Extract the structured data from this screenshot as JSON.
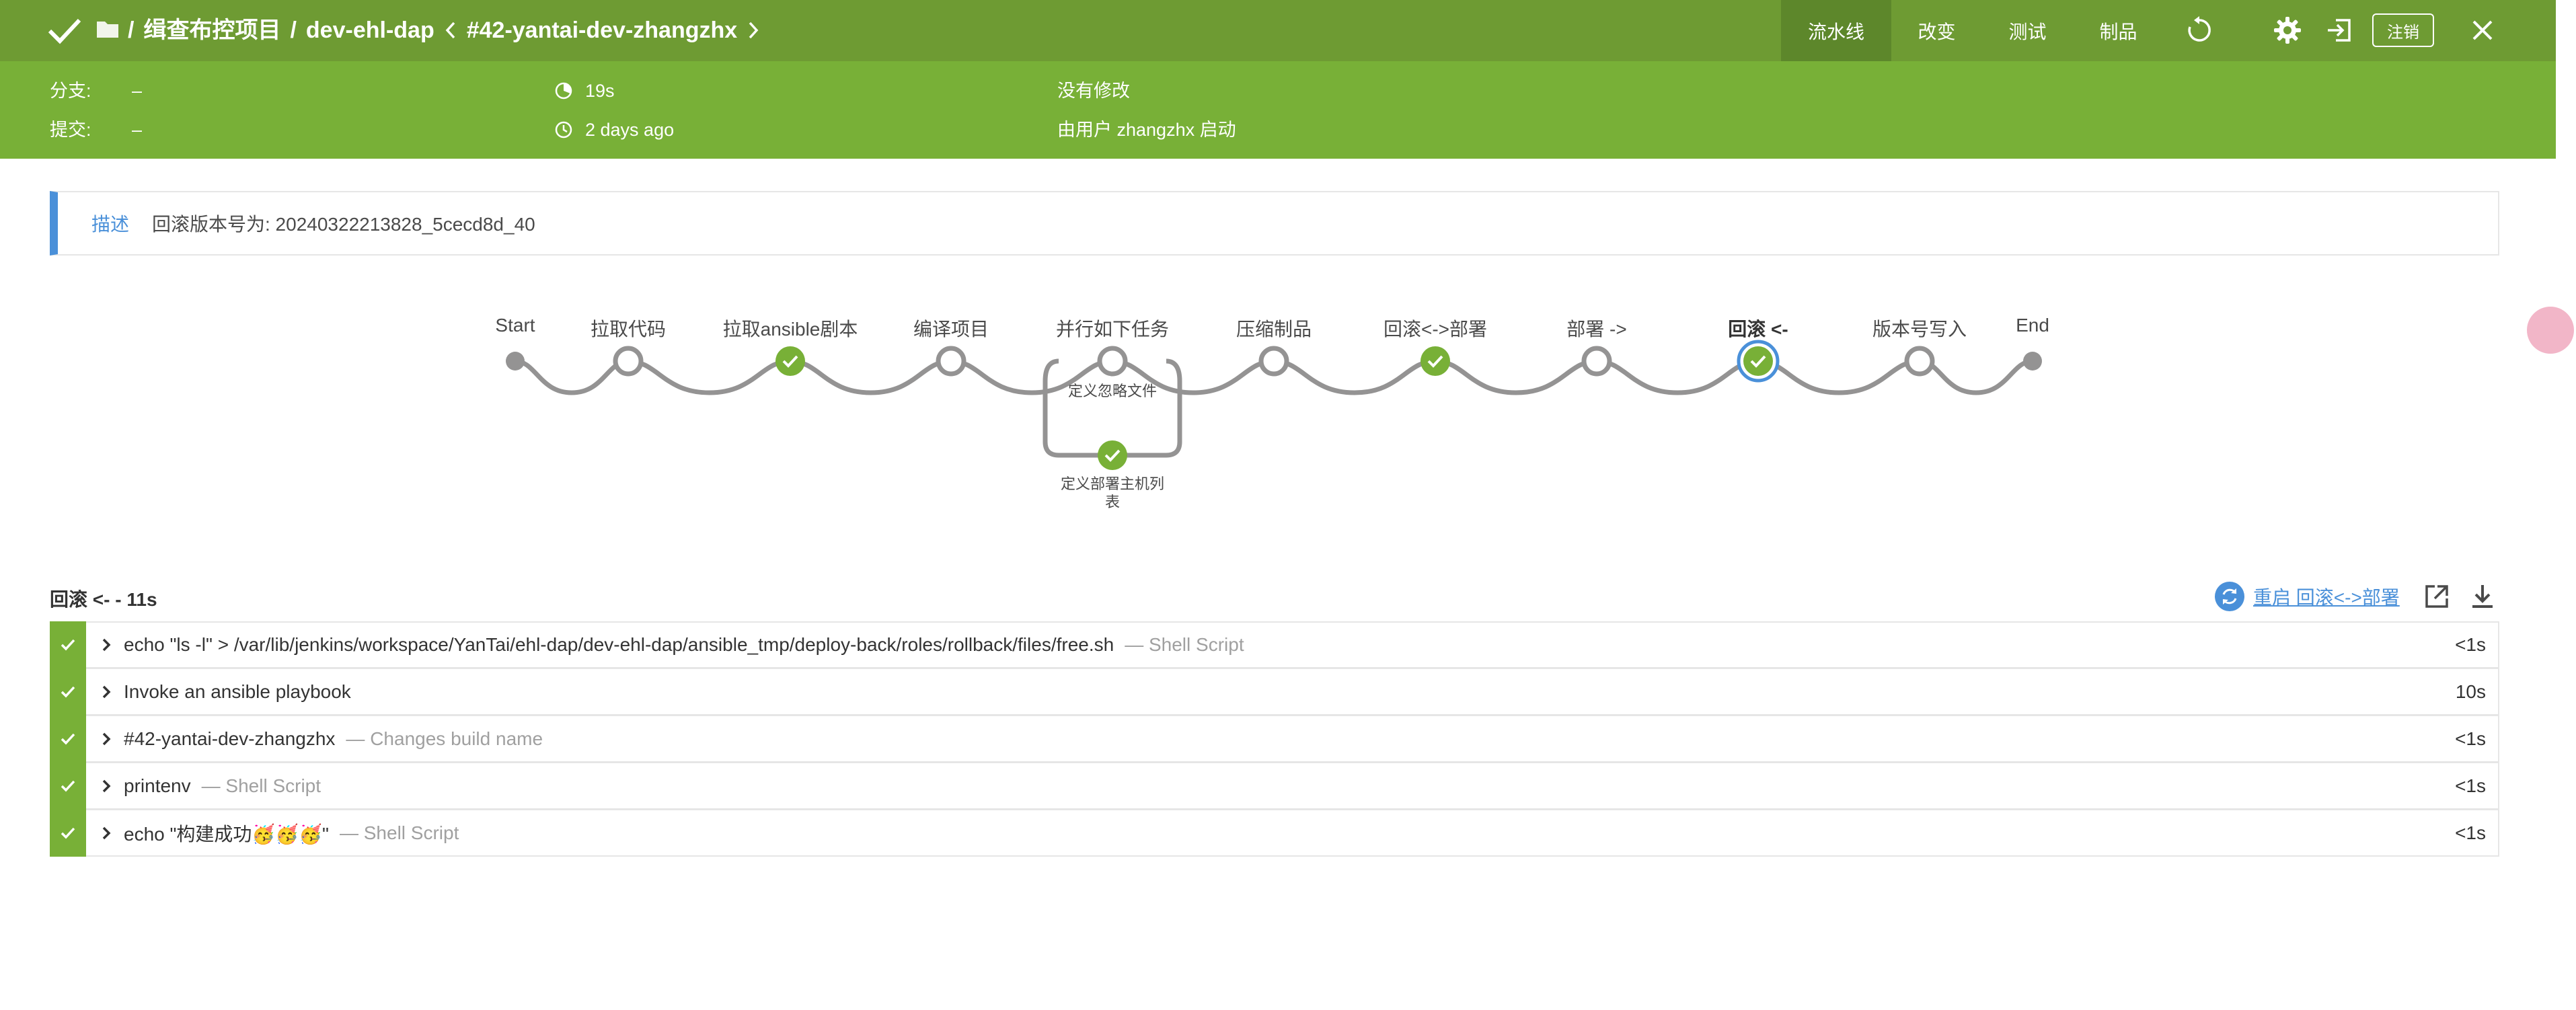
{
  "header": {
    "breadcrumb": {
      "project": "缉查布控项目",
      "job": "dev-ehl-dap",
      "build": "#42-yantai-dev-zhangzhx",
      "sep": "/"
    },
    "tabs": [
      {
        "label": "流水线",
        "active": true
      },
      {
        "label": "改变",
        "active": false
      },
      {
        "label": "测试",
        "active": false
      },
      {
        "label": "制品",
        "active": false
      }
    ],
    "logout_label": "注销",
    "icons": [
      "check-icon",
      "folder-icon",
      "chevron-left-icon",
      "chevron-right-icon",
      "replay-icon",
      "gear-icon",
      "exit-icon",
      "close-icon"
    ]
  },
  "summary": {
    "branch_label": "分支:",
    "branch_value": "–",
    "commit_label": "提交:",
    "commit_value": "–",
    "duration": "19s",
    "time_ago": "2 days ago",
    "changes": "没有修改",
    "started_by": "由用户 zhangzhx 启动"
  },
  "description": {
    "label": "描述",
    "value": "回滚版本号为: 20240322213828_5cecd8d_40"
  },
  "pipeline": {
    "stages": [
      {
        "label": "Start",
        "status": "start"
      },
      {
        "label": "拉取代码",
        "status": "not_built"
      },
      {
        "label": "拉取ansible剧本",
        "status": "success"
      },
      {
        "label": "编译项目",
        "status": "not_built"
      },
      {
        "label": "并行如下任务",
        "status": "not_built",
        "parallel": [
          {
            "label": "定义忽略文件",
            "status": "not_built"
          },
          {
            "label": "定义部署主机列表",
            "status": "success"
          }
        ]
      },
      {
        "label": "压缩制品",
        "status": "not_built"
      },
      {
        "label": "回滚<->部署",
        "status": "success"
      },
      {
        "label": "部署 ->",
        "status": "not_built"
      },
      {
        "label": "回滚 <-",
        "status": "success",
        "selected": true
      },
      {
        "label": "版本号写入",
        "status": "not_built"
      },
      {
        "label": "End",
        "status": "end"
      }
    ],
    "colors": {
      "line": "#949393",
      "success": "#78b037",
      "selected": "#4a90d9",
      "ring": "#949393"
    }
  },
  "steps_panel": {
    "title": "回滚 <- - 11s",
    "restart_label": "重启 回滚<->部署",
    "steps": [
      {
        "name": "echo \"ls -l\" > /var/lib/jenkins/workspace/YanTai/ehl-dap/dev-ehl-dap/ansible_tmp/deploy-back/roles/rollback/files/free.sh",
        "kind": "— Shell Script",
        "duration": "<1s"
      },
      {
        "name": "Invoke an ansible playbook",
        "kind": "",
        "duration": "10s"
      },
      {
        "name": "#42-yantai-dev-zhangzhx",
        "kind": "— Changes build name",
        "duration": "<1s"
      },
      {
        "name": "printenv",
        "kind": "— Shell Script",
        "duration": "<1s"
      },
      {
        "name": "echo \"构建成功🥳🥳🥳\"",
        "kind": "— Shell Script",
        "duration": "<1s"
      }
    ]
  }
}
